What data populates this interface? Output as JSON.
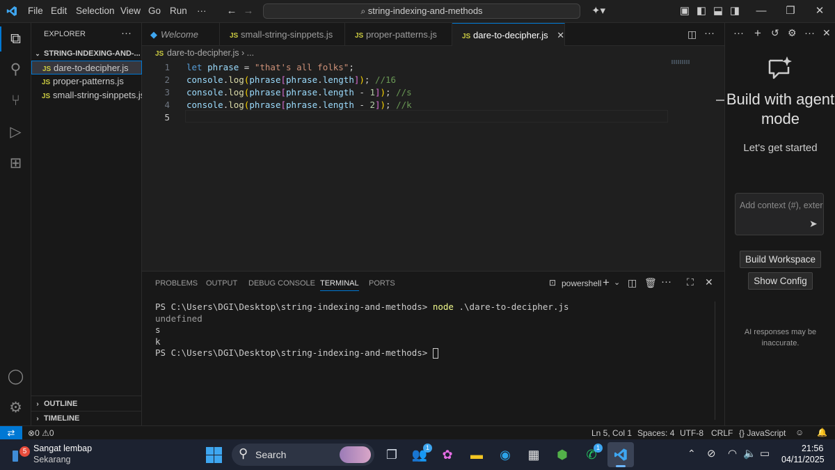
{
  "menu": [
    "File",
    "Edit",
    "Selection",
    "View",
    "Go",
    "Run",
    "···"
  ],
  "search": {
    "text": "string-indexing-and-methods"
  },
  "sidebar": {
    "title": "EXPLORER",
    "folder": "STRING-INDEXING-AND-...",
    "files": [
      "dare-to-decipher.js",
      "proper-patterns.js",
      "small-string-sinppets.js"
    ],
    "outline": "OUTLINE",
    "timeline": "TIMELINE"
  },
  "tabs": [
    {
      "label": "Welcome"
    },
    {
      "label": "small-string-sinppets.js"
    },
    {
      "label": "proper-patterns.js"
    },
    {
      "label": "dare-to-decipher.js"
    }
  ],
  "breadcrumb": {
    "file": "dare-to-decipher.js",
    "more": "..."
  },
  "editor": {
    "line_numbers": [
      "1",
      "2",
      "3",
      "4",
      "5"
    ],
    "lines": [
      "let phrase = \"that's all folks\";",
      "console.log(phrase[phrase.length]); //16",
      "console.log(phrase[phrase.length - 1]); //s",
      "console.log(phrase[phrase.length - 2]); //k",
      ""
    ]
  },
  "panel": {
    "tabs": [
      "PROBLEMS",
      "OUTPUT",
      "DEBUG CONSOLE",
      "TERMINAL",
      "PORTS"
    ],
    "shell": "powershell",
    "terminal": {
      "prompt1": "PS C:\\Users\\DGI\\Desktop\\string-indexing-and-methods> ",
      "cmd": "node",
      "arg": " .\\dare-to-decipher.js",
      "out1": "undefined",
      "out2": "s",
      "out3": "k",
      "prompt2": "PS C:\\Users\\DGI\\Desktop\\string-indexing-and-methods> "
    }
  },
  "chat": {
    "title": "Build with agent mode",
    "subtitle": "Let's get started",
    "input_placeholder": "Add context (#), exter",
    "build_button": "Build Workspace",
    "config_button": "Show Config",
    "disclaimer": "AI responses may be inaccurate."
  },
  "status": {
    "errors": "0",
    "warnings": "0",
    "position": "Ln 5, Col 1",
    "spaces": "Spaces: 4",
    "encoding": "UTF-8",
    "eol": "CRLF",
    "language": "JavaScript"
  },
  "taskbar": {
    "weather_badge": "5",
    "weather_title": "Sangat lembap",
    "weather_sub": "Sekarang",
    "search": "Search",
    "teams_badge": "1",
    "whatsapp_badge": "1",
    "time": "21:56",
    "date": "04/11/2025"
  },
  "colors": {
    "accent": "#0078d4",
    "status_remote": "#0078d4"
  }
}
